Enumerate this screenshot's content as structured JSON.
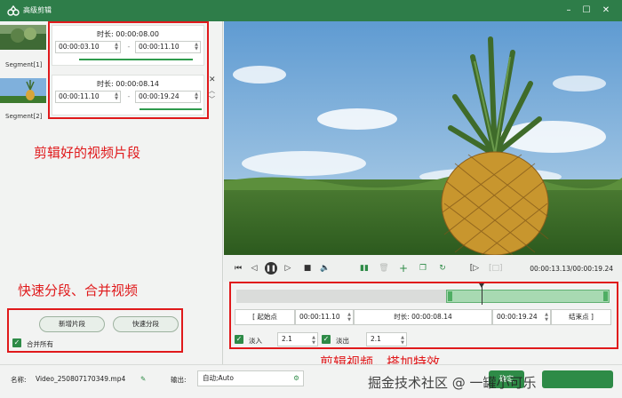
{
  "window": {
    "title": "高级剪辑"
  },
  "segments": [
    {
      "label": "Segment[1]",
      "duration": "时长: 00:00:08.00",
      "start": "00:00:03.10",
      "end": "00:00:11.10"
    },
    {
      "label": "Segment[2]",
      "duration": "时长: 00:00:08.14",
      "start": "00:00:11.10",
      "end": "00:00:19.24"
    }
  ],
  "annotations": {
    "clips": "剪辑好的视频片段",
    "split_merge": "快速分段、合并视频",
    "edit_effects": "剪辑视频，搭加特效"
  },
  "segment_actions": {
    "add_segment": "新增片段",
    "quick_split": "快速分段",
    "merge_all": "合并所有"
  },
  "player": {
    "time": "00:00:13.13/00:00:19.24"
  },
  "editor": {
    "start_point_label": "起始点",
    "start_time": "00:00:11.10",
    "duration": "时长: 00:00:08.14",
    "end_time": "00:00:19.24",
    "end_point_label": "结束点",
    "fade_in_label": "淡入",
    "fade_in_value": "2.1",
    "fade_out_label": "淡出",
    "fade_out_value": "2.1"
  },
  "bottom": {
    "name_label": "名称:",
    "filename": "Video_250807170349.mp4",
    "output_label": "输出:",
    "output_value": "自动;Auto",
    "watermark": "掘金技术社区 @ 一罐小可乐",
    "ok_label": "确定"
  },
  "colors": {
    "accent": "#2e7d49",
    "annotation": "#e0191b"
  }
}
